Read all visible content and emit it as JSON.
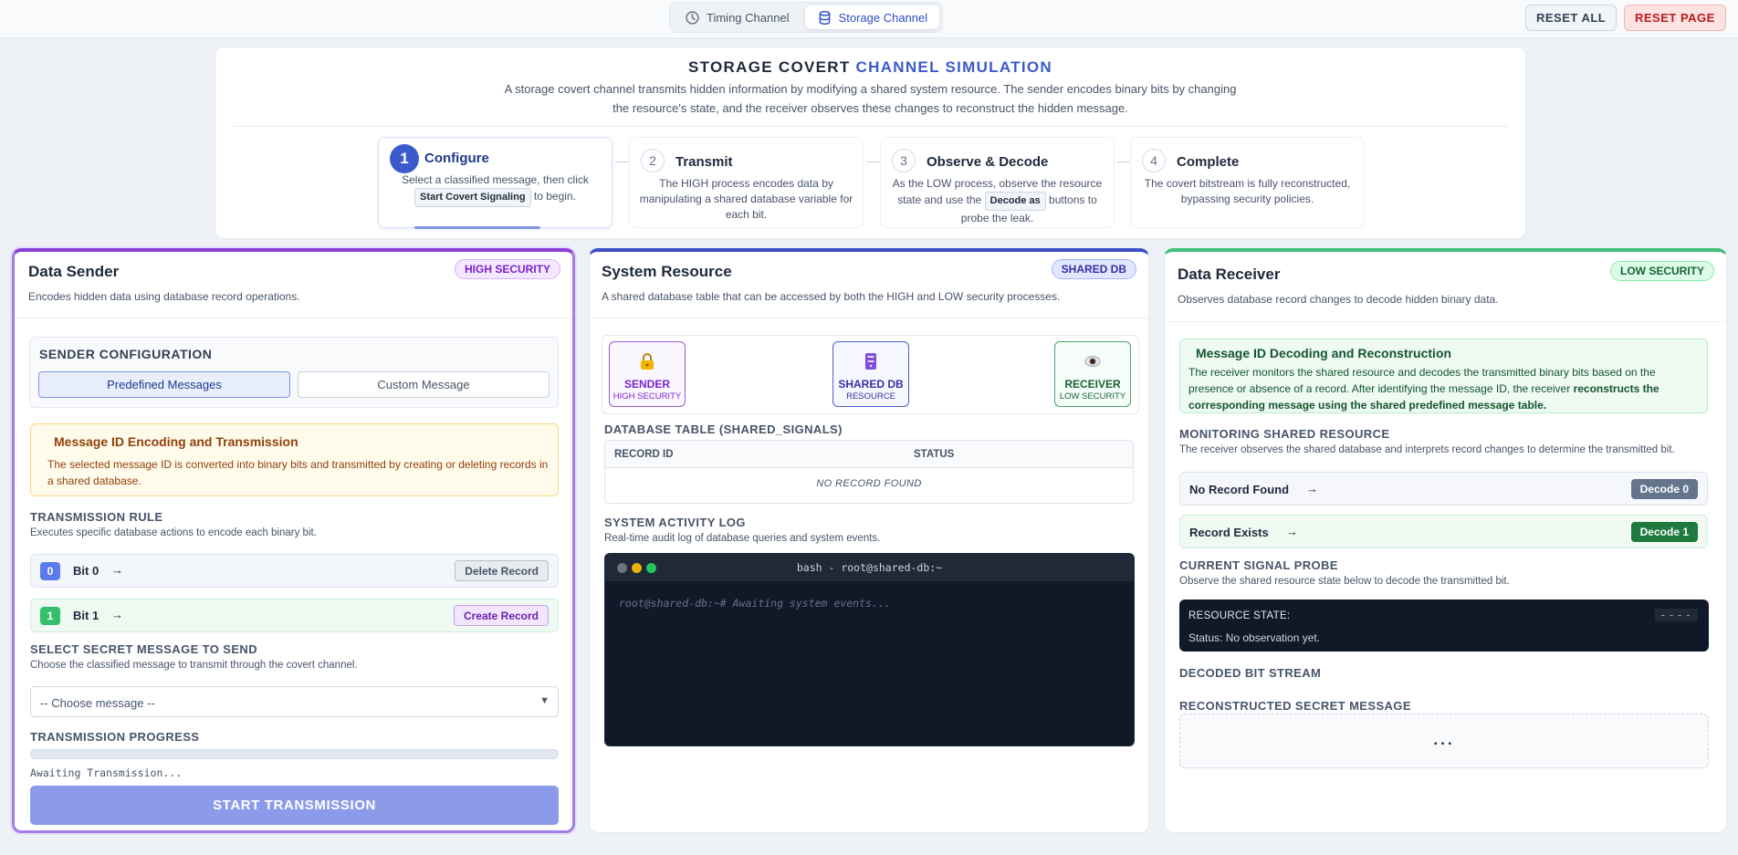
{
  "topbar": {
    "tabs": [
      {
        "label": "Timing Channel",
        "icon": "clock-icon",
        "active": false
      },
      {
        "label": "Storage Channel",
        "icon": "database-icon",
        "active": true
      }
    ],
    "reset_all": "RESET ALL",
    "reset_page": "RESET PAGE"
  },
  "intro": {
    "title_a": "STORAGE COVERT ",
    "title_b": "CHANNEL SIMULATION",
    "description": "A storage covert channel transmits hidden information by modifying a shared system resource. The sender encodes binary bits by changing the resource's state, and the receiver observes these changes to reconstruct the hidden message.",
    "steps": [
      {
        "num": "1",
        "title": "Configure",
        "desc_a": "Select a classified message, then click",
        "desc_kbd": "Start Covert Signaling",
        "desc_b": "to begin."
      },
      {
        "num": "2",
        "title": "Transmit",
        "desc": "The HIGH process encodes data by manipulating a shared database variable for each bit."
      },
      {
        "num": "3",
        "title": "Observe & Decode",
        "desc_a": "As the LOW process, observe the resource state and use the",
        "desc_kbd": "Decode as",
        "desc_b": "buttons to probe the leak."
      },
      {
        "num": "4",
        "title": "Complete",
        "desc": "The covert bitstream is fully reconstructed, bypassing security policies."
      }
    ]
  },
  "sender": {
    "title": "Data Sender",
    "badge": "HIGH SECURITY",
    "subtitle": "Encodes hidden data using database record operations.",
    "config_title": "SENDER CONFIGURATION",
    "mode_predefined": "Predefined Messages",
    "mode_custom": "Custom Message",
    "info_title": "Message ID Encoding and Transmission",
    "info_desc": "The selected message ID is converted into binary bits and transmitted by creating or deleting records in a shared database.",
    "rule_label": "TRANSMISSION RULE",
    "rule_sub": "Executes specific database actions to encode each binary bit.",
    "rules": [
      {
        "chip": "0",
        "label": "Bit 0",
        "arrow": "→",
        "action": "Delete Record"
      },
      {
        "chip": "1",
        "label": "Bit 1",
        "arrow": "→",
        "action": "Create Record"
      }
    ],
    "select_label": "SELECT SECRET MESSAGE TO SEND",
    "select_sub": "Choose the classified message to transmit through the covert channel.",
    "select_value": "-- Choose message --",
    "progress_label": "TRANSMISSION PROGRESS",
    "progress_value": 0,
    "progress_text": "Awaiting Transmission...",
    "start_button": "START TRANSMISSION"
  },
  "resource": {
    "title": "System Resource",
    "badge": "SHARED DB",
    "subtitle": "A shared database table that can be accessed by both the HIGH and LOW security processes.",
    "nodes": [
      {
        "name": "SENDER",
        "sub": "HIGH SECURITY",
        "icon": "lock-icon"
      },
      {
        "name": "SHARED DB",
        "sub": "RESOURCE",
        "icon": "server-icon"
      },
      {
        "name": "RECEIVER",
        "sub": "LOW SECURITY",
        "icon": "eye-icon"
      }
    ],
    "table_label": "DATABASE TABLE (SHARED_SIGNALS)",
    "col_record_id": "RECORD ID",
    "col_status": "STATUS",
    "empty_text": "NO RECORD FOUND",
    "log_label": "SYSTEM ACTIVITY LOG",
    "log_sub": "Real-time audit log of database queries and system events.",
    "terminal_title": "bash - root@shared-db:~",
    "terminal_line": "root@shared-db:~# Awaiting system events..."
  },
  "receiver": {
    "title": "Data Receiver",
    "badge": "LOW SECURITY",
    "subtitle": "Observes database record changes to decode hidden binary data.",
    "info_title": "Message ID Decoding and Reconstruction",
    "info_desc_a": "The receiver monitors the shared resource and decodes the transmitted binary bits based on the presence or absence of a record. After identifying the message ID, the receiver ",
    "info_desc_b": "reconstructs the corresponding message using the shared predefined message table.",
    "monitor_label": "MONITORING SHARED RESOURCE",
    "monitor_sub": "The receiver observes the shared database and interprets record changes to determine the transmitted bit.",
    "decodes": [
      {
        "label": "No Record Found",
        "arrow": "→",
        "button": "Decode 0"
      },
      {
        "label": "Record Exists",
        "arrow": "→",
        "button": "Decode 1"
      }
    ],
    "probe_label": "CURRENT SIGNAL PROBE",
    "probe_sub": "Observe the shared resource state below to decode the transmitted bit.",
    "probe_state_label": "RESOURCE STATE:",
    "probe_status": "Status: No observation yet.",
    "probe_value": "----",
    "bitstream_label": "DECODED BIT STREAM",
    "secret_label": "RECONSTRUCTED SECRET MESSAGE",
    "secret_value": "..."
  },
  "colors": {
    "accent": "#3b5bcc",
    "high": "#8b3fd9",
    "db": "#3b4fc4",
    "low": "#3fbf7a"
  }
}
